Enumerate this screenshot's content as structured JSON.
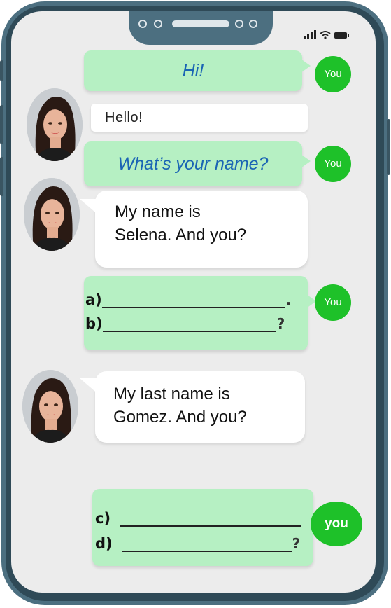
{
  "phone": {
    "frame_color": "#4c6f80",
    "screen_color": "#ececec",
    "accent_green": "#1ec129",
    "bubble_green": "#b6f0c3"
  },
  "status_icons": [
    "signal-icon",
    "wifi-icon",
    "battery-icon"
  ],
  "messages": [
    {
      "sender": "you",
      "text": "Hi!",
      "badge": "You"
    },
    {
      "sender": "selena",
      "text": "Hello!"
    },
    {
      "sender": "you",
      "text": "What’s your name?",
      "badge": "You"
    },
    {
      "sender": "selena",
      "text_line1": "My name is",
      "text_line2": "Selena. And you?"
    },
    {
      "sender": "you",
      "badge": "You",
      "answers": [
        {
          "label": "a)",
          "end": "."
        },
        {
          "label": "b)",
          "end": "?"
        }
      ]
    },
    {
      "sender": "selena",
      "text_line1": "My last name is",
      "text_line2": "Gomez. And you?"
    },
    {
      "sender": "you",
      "badge": "you",
      "answers": [
        {
          "label": "c)",
          "end": ""
        },
        {
          "label": "d)",
          "end": "?"
        }
      ]
    }
  ]
}
